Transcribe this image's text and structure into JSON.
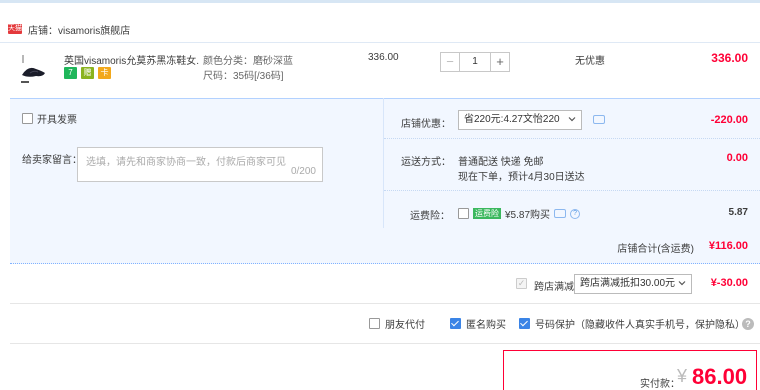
{
  "store": {
    "badge": "天猫",
    "label": "店铺：visamoris旗舰店"
  },
  "item": {
    "title": "英国visamoris允莫苏黑冻鞋女...",
    "sku_color": "颜色分类：磨砂深蓝",
    "sku_size": "尺码：35码[/36码]",
    "unit_price": "336.00",
    "quantity": "1",
    "minus": "−",
    "plus": "+",
    "discount": "无优惠",
    "total": "336.00",
    "icons": [
      "7",
      "赠",
      "卡"
    ]
  },
  "panel": {
    "invoice_label": "开具发票",
    "message_label": "给卖家留言：",
    "message_placeholder": "选填，请先和商家协商一致，付款后商家可见",
    "message_count": "0/200",
    "store_coupon_label": "店铺优惠：",
    "store_coupon_value": "省220元:4.27文怡220",
    "store_coupon_amount": "-220.00",
    "shipping_label": "运送方式：",
    "shipping_line1": "普通配送 快递 免邮",
    "shipping_line2": "现在下单，预计4月30日送达",
    "shipping_amount": "0.00",
    "insurance_label": "运费险：",
    "insurance_logo": "运费险",
    "insurance_text": "¥5.87购买",
    "insurance_amount": "5.87",
    "store_total_label": "店铺合计(含运费)",
    "store_total_value": "¥116.00"
  },
  "cross_store": {
    "label": "跨店满减",
    "select_value": "跨店满减抵扣30.00元",
    "amount": "¥-30.00"
  },
  "options": {
    "friend_pay": "朋友代付",
    "anonymous": "匿名购买",
    "number_protect": "号码保护（隐藏收件人真实手机号，保护隐私）"
  },
  "payment": {
    "label": "实付款：",
    "currency": "¥",
    "value": "86.00"
  },
  "colors": {
    "accent_red": "#ff0036",
    "panel_blue": "#f2f7ff",
    "checkbox_blue": "#3b84e6"
  }
}
